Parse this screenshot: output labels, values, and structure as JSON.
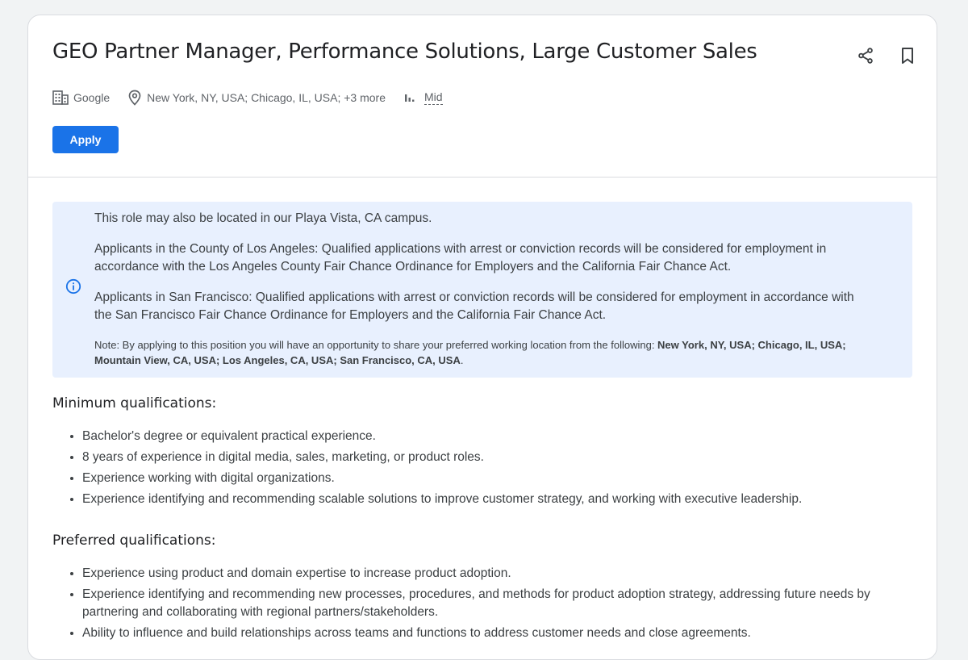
{
  "job": {
    "title": "GEO Partner Manager, Performance Solutions, Large Customer Sales",
    "company": "Google",
    "locations": "New York, NY, USA; Chicago, IL, USA; +3 more",
    "level": "Mid",
    "apply_label": "Apply"
  },
  "icons": {
    "share": "share-icon",
    "bookmark": "bookmark-icon",
    "company": "building-icon",
    "location": "location-pin-icon",
    "level": "bar-chart-icon",
    "info": "info-icon"
  },
  "colors": {
    "accent": "#1a73e8",
    "notice_bg": "#e8f0fe"
  },
  "notice": {
    "line1": "This role may also be located in our Playa Vista, CA campus.",
    "line2": "Applicants in the County of Los Angeles: Qualified applications with arrest or conviction records will be considered for employment in accordance with the Los Angeles County Fair Chance Ordinance for Employers and the California Fair Chance Act.",
    "line3": "Applicants in San Francisco: Qualified applications with arrest or conviction records will be considered for employment in accordance with the San Francisco Fair Chance Ordinance for Employers and the California Fair Chance Act.",
    "note_prefix": "Note: By applying to this position you will have an opportunity to share your preferred working location from the following: ",
    "note_locations": "New York, NY, USA; Chicago, IL, USA; Mountain View, CA, USA; Los Angeles, CA, USA; San Francisco, CA, USA",
    "note_suffix": "."
  },
  "minimum": {
    "heading": "Minimum qualifications:",
    "items": [
      "Bachelor's degree or equivalent practical experience.",
      "8 years of experience in digital media, sales, marketing, or product roles.",
      "Experience working with digital organizations.",
      "Experience identifying and recommending scalable solutions to improve customer strategy, and working with executive leadership."
    ]
  },
  "preferred": {
    "heading": "Preferred qualifications:",
    "items": [
      "Experience using product and domain expertise to increase product adoption.",
      "Experience identifying and recommending new processes, procedures, and methods for product adoption strategy, addressing future needs by partnering and collaborating with regional partners/stakeholders.",
      "Ability to influence and build relationships across teams and functions to address customer needs and close agreements."
    ]
  }
}
